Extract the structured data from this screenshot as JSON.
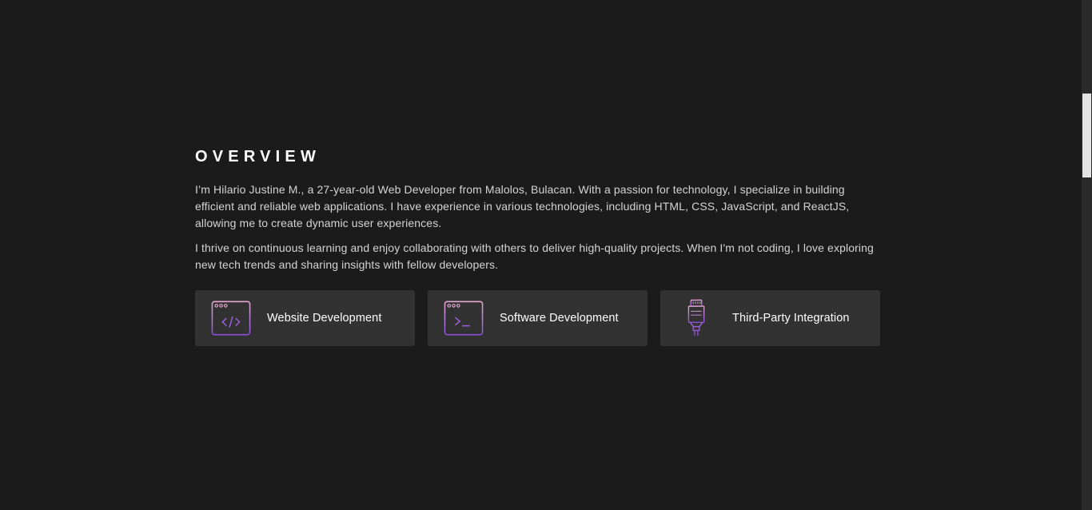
{
  "overview": {
    "title": "OVERVIEW",
    "paragraphs": [
      "I’m Hilario Justine M., a 27-year-old Web Developer from Malolos, Bulacan. With a passion for technology, I specialize in building efficient and reliable web applications. I have experience in various technologies, including HTML, CSS, JavaScript, and ReactJS, allowing me to create dynamic user experiences.",
      "I thrive on continuous learning and enjoy collaborating with others to deliver high-quality projects. When I'm not coding, I love exploring new tech trends and sharing insights with fellow developers."
    ]
  },
  "services": [
    {
      "label": "Website Development",
      "icon": "code-window-icon"
    },
    {
      "label": "Software Development",
      "icon": "terminal-window-icon"
    },
    {
      "label": "Third-Party Integration",
      "icon": "ethernet-plug-icon"
    }
  ],
  "colors": {
    "background": "#1b1b1b",
    "card": "#323232",
    "icon_gradient_start": "#e6a8d6",
    "icon_gradient_end": "#8a4fd8"
  }
}
